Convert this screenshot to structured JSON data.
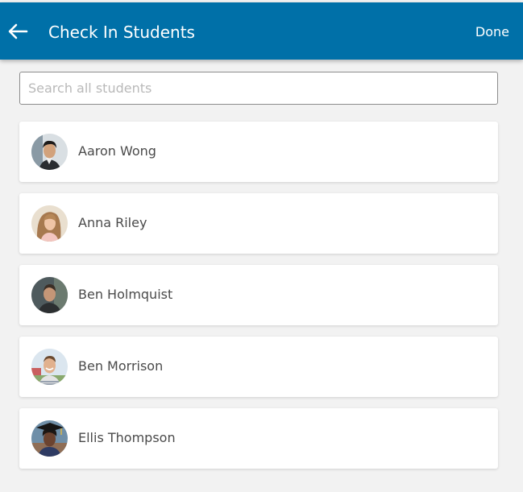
{
  "header": {
    "title": "Check In Students",
    "done_label": "Done",
    "background": "#0070a8"
  },
  "search": {
    "placeholder": "Search all students",
    "value": ""
  },
  "students": [
    {
      "name": "Aaron Wong",
      "avatar": "student-photo"
    },
    {
      "name": "Anna Riley",
      "avatar": "student-photo"
    },
    {
      "name": "Ben Holmquist",
      "avatar": "student-photo"
    },
    {
      "name": "Ben Morrison",
      "avatar": "student-photo"
    },
    {
      "name": "Ellis Thompson",
      "avatar": "student-photo"
    }
  ]
}
